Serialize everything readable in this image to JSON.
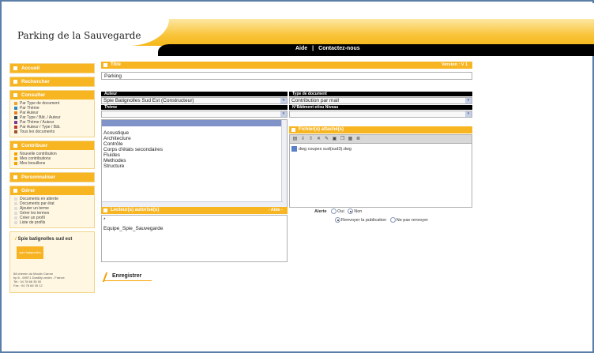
{
  "header": {
    "site_title": "Parking de la Sauvegarde",
    "nav": {
      "aide": "Aide",
      "separator": "|",
      "contact": "Contactez-nous"
    }
  },
  "sidebar": {
    "accueil": "Accueil",
    "rechercher": "Rechercher",
    "consulter": {
      "title": "Consulter",
      "items": [
        {
          "label": "Par Type de document",
          "color": "#f2a12a"
        },
        {
          "label": "Par Thème",
          "color": "#2e86c1"
        },
        {
          "label": "Par Auteur",
          "color": "#e67e22"
        },
        {
          "label": "Par Type / Bât. / Auteur",
          "color": "#34495e"
        },
        {
          "label": "Par Thème / Auteur",
          "color": "#7d3c98"
        },
        {
          "label": "Par Auteur / Type / Bât.",
          "color": "#c0392b"
        },
        {
          "label": "Tous les documents",
          "color": "#a0522d"
        }
      ]
    },
    "contribuer": {
      "title": "Contribuer",
      "items": [
        "Nouvelle contribution",
        "Mes contributions",
        "Mes brouillons"
      ]
    },
    "personnaliser": "Personnaliser",
    "gerer": {
      "title": "Gérer",
      "items": [
        "Documents en attente",
        "Documents par état",
        "Ajouter un terme",
        "Gérer les termes",
        "Créer un profil",
        "Liste de profils"
      ]
    },
    "brand": {
      "slash": "/",
      "name": "Spie batignolles sud est",
      "logo_text": "spie batignolles",
      "address": [
        "68 chemin du Moulin Carron",
        "bp 6 - 69571 Dardilly cedex - France",
        "Tel : 04 78 66 35 00",
        "Fax : 04 78 66 35 12"
      ]
    }
  },
  "form": {
    "titre_label": "Titre",
    "version": "Version : V 1",
    "titre_value": "Parking",
    "auteur_label": "Auteur",
    "auteur_value": "Spie Batignolles Sud Est (Constructeur)",
    "type_label": "Type de document",
    "type_value": "Contribution par mail",
    "theme_label": "Thème",
    "theme_value": "",
    "batiment_label": "N°Bâtiment et/ou Niveau",
    "batiment_value": "",
    "theme_list": [
      "Acoustique",
      "Architecture",
      "Contrôle",
      "Corps d'états secondaires",
      "Fluides",
      "Methodes",
      "Structure"
    ],
    "fichiers_label": "Fichier(s) attaché(s)",
    "file_name": "dwg coupes sud(sud3).dwg",
    "lecteurs_label": "Lecteur(s) autorisé(s)",
    "lecteurs_aide": "- Aide -",
    "lecteurs": [
      "*",
      "Equipe_Spie_Sauvegarde"
    ],
    "alerte_label": "Alerte",
    "alerte_oui": "Oui",
    "alerte_non": "Non",
    "renvoyer": "Renvoyer la publication",
    "ne_pas_renvoyer": "Ne pas renvoyer",
    "save": "Enregistrer"
  }
}
